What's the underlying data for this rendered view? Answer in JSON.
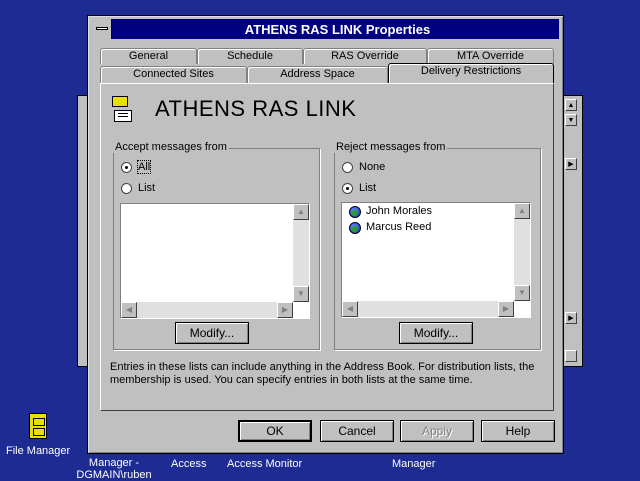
{
  "dialog": {
    "title": "ATHENS RAS LINK Properties",
    "heading": "ATHENS RAS LINK"
  },
  "tabs": {
    "row1": [
      "General",
      "Schedule",
      "RAS Override",
      "MTA Override"
    ],
    "row2": [
      "Connected Sites",
      "Address Space",
      "Delivery Restrictions"
    ],
    "active": "Delivery Restrictions"
  },
  "accept": {
    "group_label": "Accept messages from",
    "options": [
      "All",
      "List"
    ],
    "selected": "All",
    "entries": [],
    "modify_label": "Modify..."
  },
  "reject": {
    "group_label": "Reject messages from",
    "options": [
      "None",
      "List"
    ],
    "selected": "List",
    "entries": [
      "John Morales",
      "Marcus Reed"
    ],
    "modify_label": "Modify..."
  },
  "info_text": "Entries in these lists can include anything in the Address Book. For distribution lists, the membership is used. You can specify entries in both lists at the same time.",
  "buttons": {
    "ok": "OK",
    "cancel": "Cancel",
    "apply": "Apply",
    "help": "Help"
  },
  "desktop": {
    "icons": [
      {
        "label": "File Manager",
        "icon": "file-cabinet-icon"
      },
      {
        "label": "Manager -\nDGMAIN\\ruben",
        "icon": "app-icon"
      },
      {
        "label": "Access",
        "icon": "app-icon"
      },
      {
        "label": "Access Monitor",
        "icon": "app-icon"
      },
      {
        "label": "Manager",
        "icon": "app-icon"
      }
    ]
  }
}
